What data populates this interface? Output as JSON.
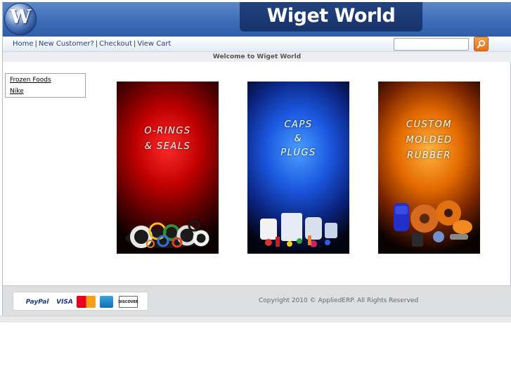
{
  "header": {
    "logo_letter": "W",
    "site_title": "Wiget World"
  },
  "nav": {
    "links": [
      "Home",
      "New Customer?",
      "Checkout",
      "View Cart"
    ],
    "separator": "|",
    "search": {
      "value": "",
      "button_icon": "search-icon"
    }
  },
  "welcome": {
    "text": "Welcome to Wiget World"
  },
  "sidebar": {
    "items": [
      {
        "label": "Frozen Foods"
      },
      {
        "label": "Nike"
      }
    ]
  },
  "banners": [
    {
      "lines": [
        "O-RINGS",
        "& SEALS"
      ],
      "theme": "#c00000"
    },
    {
      "lines": [
        "CAPS",
        "&",
        "PLUGS"
      ],
      "theme": "#1b57e0"
    },
    {
      "lines": [
        "CUSTOM",
        "MOLDED",
        "RUBBER"
      ],
      "theme": "#e46a00"
    }
  ],
  "footer": {
    "payment_methods": [
      "PayPal",
      "VISA",
      "MasterCard",
      "American Express",
      "DISCOVER"
    ],
    "copyright": "Copyright 2010 © AppliedERP. All Rights Reserved"
  },
  "colors": {
    "header_blue": "#3e6db8",
    "title_box": "#1c3a76",
    "nav_link": "#1f3f8a",
    "search_button": "#e2701c"
  }
}
